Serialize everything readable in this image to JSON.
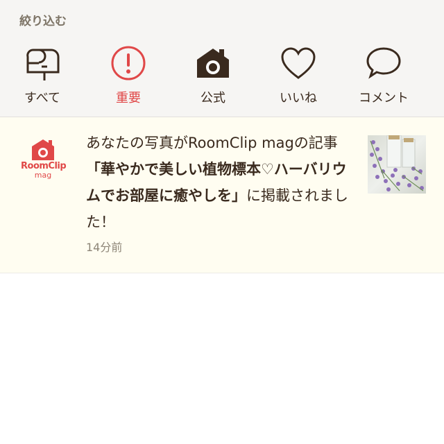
{
  "filter": {
    "title": "絞り込む",
    "tabs": [
      {
        "label": "すべて",
        "icon": "mailbox-icon",
        "active": false
      },
      {
        "label": "重要",
        "icon": "exclamation-circle-icon",
        "active": true
      },
      {
        "label": "公式",
        "icon": "camera-house-icon",
        "active": false
      },
      {
        "label": "いいね",
        "icon": "heart-icon",
        "active": false
      },
      {
        "label": "コメント",
        "icon": "speech-bubble-icon",
        "active": false
      }
    ]
  },
  "notification": {
    "logo": {
      "line1": "RoomClip",
      "line2": "mag"
    },
    "message": {
      "prefix": "あなたの写真がRoomClip magの記事",
      "title": "「華やかで美しい植物標本♡ハーバリウムでお部屋に癒やしを」",
      "suffix": "に掲載されました！"
    },
    "time": "14分前",
    "thumbnail_icon": "herbarium-photo"
  },
  "colors": {
    "accent": "#e04848",
    "icon": "#3a2a1e",
    "panel_bg": "#f6f5f3",
    "notification_bg": "#fffdf1"
  }
}
